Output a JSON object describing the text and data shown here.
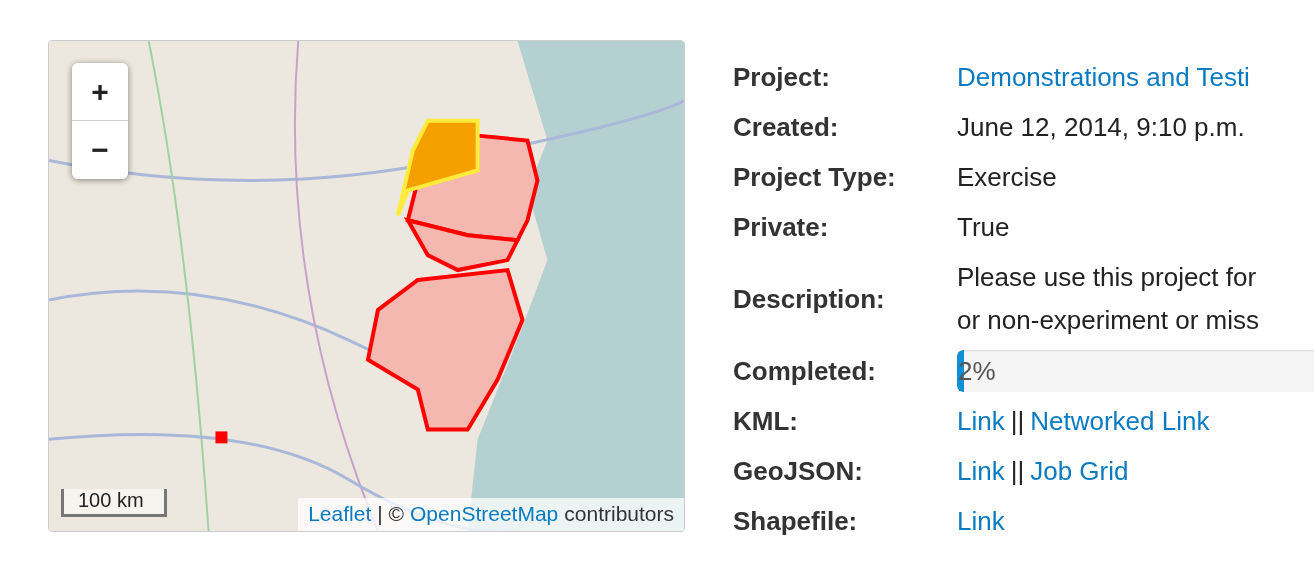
{
  "map": {
    "zoom_in": "+",
    "zoom_out": "−",
    "scale": "100 km",
    "attribution": [
      {
        "kind": "link",
        "text": "Leaflet"
      },
      {
        "kind": "text",
        "text": "| ©"
      },
      {
        "kind": "link",
        "text": "OpenStreetMap"
      },
      {
        "kind": "text",
        "text": "contributors"
      }
    ]
  },
  "rows": [
    {
      "label": "Project:",
      "kind": "link",
      "value": "Demonstrations and Testi"
    },
    {
      "label": "Created:",
      "kind": "text",
      "value": "June 12, 2014, 9:10 p.m."
    },
    {
      "label": "Project Type:",
      "kind": "text",
      "value": "Exercise"
    },
    {
      "label": "Private:",
      "kind": "text",
      "value": "True"
    },
    {
      "label": "Description:",
      "kind": "paragraph",
      "lines": [
        "Please use this project for",
        "or non-experiment or miss"
      ]
    },
    {
      "label": "Completed:",
      "kind": "progress",
      "level": 0.02,
      "reading": "2%"
    },
    {
      "label": "KML:",
      "kind": "links",
      "links": [
        "Link",
        "Networked Link"
      ],
      "separator": "||"
    },
    {
      "label": "GeoJSON:",
      "kind": "links",
      "links": [
        "Link",
        "Job Grid"
      ],
      "separator": "||"
    },
    {
      "label": "Shapefile:",
      "kind": "link",
      "value": "Link"
    }
  ]
}
